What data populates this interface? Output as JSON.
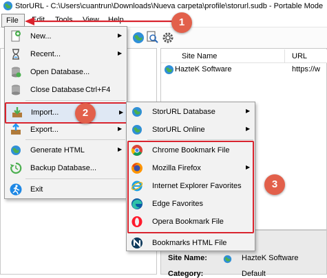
{
  "window": {
    "title": "StorURL - C:\\Users\\cuantrun\\Downloads\\Nueva carpeta\\profile\\storurl.sudb - Portable Mode"
  },
  "menubar": [
    "File",
    "Edit",
    "Tools",
    "View",
    "Help"
  ],
  "file_menu": {
    "new": "New...",
    "recent": "Recent...",
    "open_db": "Open Database...",
    "close_db": "Close Database",
    "close_db_shortcut": "Ctrl+F4",
    "import": "Import...",
    "export": "Export...",
    "generate_html": "Generate HTML",
    "backup": "Backup Database...",
    "exit": "Exit"
  },
  "import_submenu": {
    "storurl_db": "StorURL Database",
    "storurl_online": "StorURL Online",
    "chrome": "Chrome Bookmark File",
    "firefox": "Mozilla Firefox",
    "ie": "Internet Explorer Favorites",
    "edge": "Edge Favorites",
    "opera": "Opera Bookmark File",
    "html": "Bookmarks HTML File"
  },
  "list": {
    "col_site": "Site Name",
    "col_url": "URL",
    "row_site": "HazteK Software",
    "row_url": "https://w"
  },
  "details": {
    "site_label": "Site Name:",
    "site_value": "HazteK Software",
    "category_label": "Category:",
    "category_value": "Default"
  },
  "annotations": {
    "one": "1",
    "two": "2",
    "three": "3"
  },
  "colors": {
    "annotation": "#e2604b",
    "highlight": "#d9232d"
  }
}
